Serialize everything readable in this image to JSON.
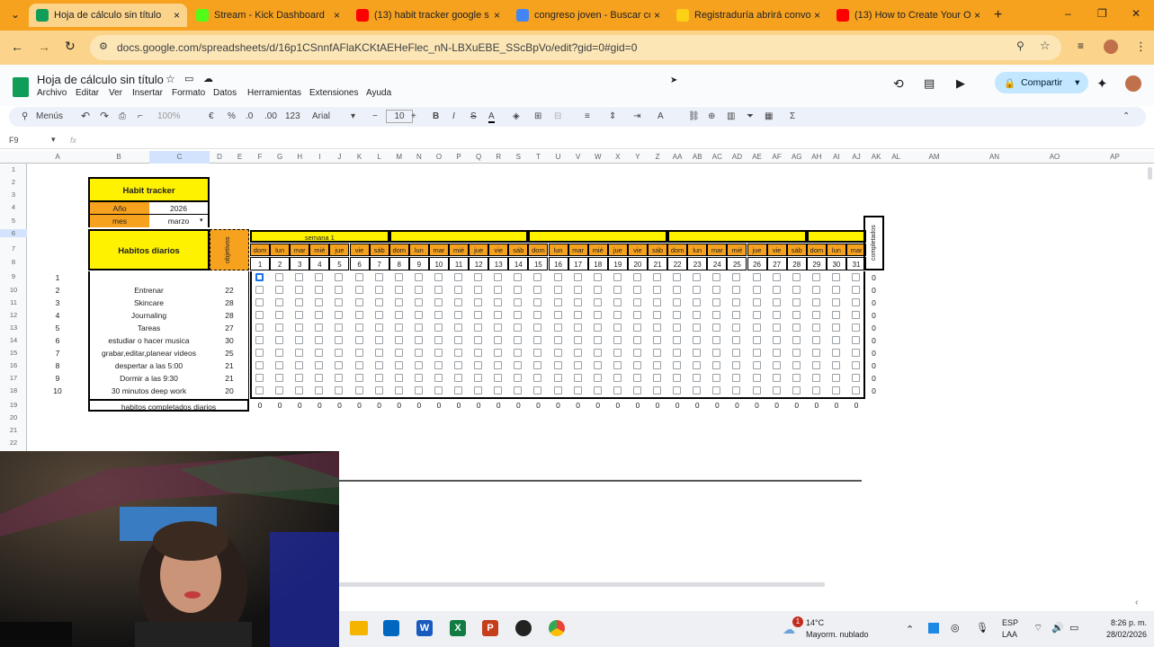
{
  "browser": {
    "tabs": [
      {
        "label": "Hoja de cálculo sin título",
        "color": "#0f9d58",
        "active": true
      },
      {
        "label": "Stream - Kick Dashboard",
        "color": "#53fc18"
      },
      {
        "label": "(13) habit tracker google s",
        "color": "#ff0000"
      },
      {
        "label": "congreso joven - Buscar co",
        "color": "#4285f4"
      },
      {
        "label": "Registraduría abrirá convo",
        "color": "#fcd116"
      },
      {
        "label": "(13) How to Create Your O",
        "color": "#ff0000"
      }
    ],
    "close_glyph": "×",
    "new_tab": "+",
    "window_controls": [
      "–",
      "❐",
      "✕"
    ],
    "url": "docs.google.com/spreadsheets/d/16p1CSnnfAFlaKCKtAEHeFlec_nN-LBXuEBE_SScBpVo/edit?gid=0#gid=0"
  },
  "doc": {
    "title": "Hoja de cálculo sin título",
    "menus": [
      "Archivo",
      "Editar",
      "Ver",
      "Insertar",
      "Formato",
      "Datos",
      "Herramientas",
      "Extensiones",
      "Ayuda"
    ],
    "share_label": "Compartir"
  },
  "toolbar": {
    "menus_label": "Menús",
    "zoom": "100%",
    "currency": "€",
    "percent": "%",
    "decrease_decimals": ".0",
    "increase_decimals": ".00",
    "number_format": "123",
    "font": "Arial",
    "font_size": "10",
    "minus": "−",
    "plus": "+",
    "bold": "B",
    "italic": "I",
    "strike": "S",
    "text_color": "A"
  },
  "formula": {
    "cell_ref": "F9",
    "fx": "fx"
  },
  "columns": [
    "A",
    "B",
    "C",
    "D",
    "E",
    "F",
    "G",
    "H",
    "I",
    "J",
    "K",
    "L",
    "M",
    "N",
    "O",
    "P",
    "Q",
    "R",
    "S",
    "T",
    "U",
    "V",
    "W",
    "X",
    "Y",
    "Z",
    "AA",
    "AB",
    "AC",
    "AD",
    "AE",
    "AF",
    "AG",
    "AH",
    "AI",
    "AJ",
    "AK",
    "AL",
    "AM",
    "AN",
    "AO",
    "AP"
  ],
  "rows": [
    "1",
    "2",
    "3",
    "4",
    "5",
    "6",
    "7",
    "8",
    "9",
    "10",
    "11",
    "12",
    "13",
    "14",
    "15",
    "16",
    "17",
    "18",
    "19",
    "20",
    "21",
    "22"
  ],
  "tracker": {
    "title": "Habit tracker",
    "year_label": "Año",
    "year_value": "2026",
    "month_label": "mes",
    "month_value": "marzo",
    "habits_header": "Habitos diarios",
    "objetivos_header": "objetivos",
    "week_label": "semana 1",
    "completados_header": "completados",
    "day_names": [
      "dom",
      "lun",
      "mar",
      "mié",
      "jue",
      "vie",
      "sáb",
      "dom",
      "lun",
      "mar",
      "mié",
      "jue",
      "vie",
      "sáb",
      "dom",
      "lun",
      "mar",
      "mié",
      "jue",
      "vie",
      "sáb",
      "dom",
      "lun",
      "mar",
      "mié",
      "jue",
      "vie",
      "sáb",
      "dom",
      "lun",
      "mar"
    ],
    "day_numbers": [
      "1",
      "2",
      "3",
      "4",
      "5",
      "6",
      "7",
      "8",
      "9",
      "10",
      "11",
      "12",
      "13",
      "14",
      "15",
      "16",
      "17",
      "18",
      "19",
      "20",
      "21",
      "22",
      "23",
      "24",
      "25",
      "26",
      "27",
      "28",
      "29",
      "30",
      "31"
    ],
    "habits": [
      {
        "n": "1",
        "name": "",
        "goal": "",
        "done": "0"
      },
      {
        "n": "2",
        "name": "Entrenar",
        "goal": "22",
        "done": "0"
      },
      {
        "n": "3",
        "name": "Skincare",
        "goal": "28",
        "done": "0"
      },
      {
        "n": "4",
        "name": "Journaling",
        "goal": "28",
        "done": "0"
      },
      {
        "n": "5",
        "name": "Tareas",
        "goal": "27",
        "done": "0"
      },
      {
        "n": "6",
        "name": "estudiar o hacer musica",
        "goal": "30",
        "done": "0"
      },
      {
        "n": "7",
        "name": "grabar,editar,planear videos",
        "goal": "25",
        "done": "0"
      },
      {
        "n": "8",
        "name": "despertar a las 5:00",
        "goal": "21",
        "done": "0"
      },
      {
        "n": "9",
        "name": "Dormir a las 9:30",
        "goal": "21",
        "done": "0"
      },
      {
        "n": "10",
        "name": "30 minutos deep work",
        "goal": "20",
        "done": "0"
      }
    ],
    "daily_label": "habitos completados diarios",
    "daily_total": "0"
  },
  "taskbar": {
    "weather_temp": "14°C",
    "weather_desc": "Mayorm. nublado",
    "notif_count": "1",
    "lang": "ESP",
    "lang2": "LAA",
    "time": "8:26 p. m.",
    "date": "28/02/2026"
  },
  "colors": {
    "yellow": "#fff200",
    "orange": "#f7a21f",
    "sheets_green": "#0f9d58",
    "share_blue": "#c2e7ff"
  }
}
